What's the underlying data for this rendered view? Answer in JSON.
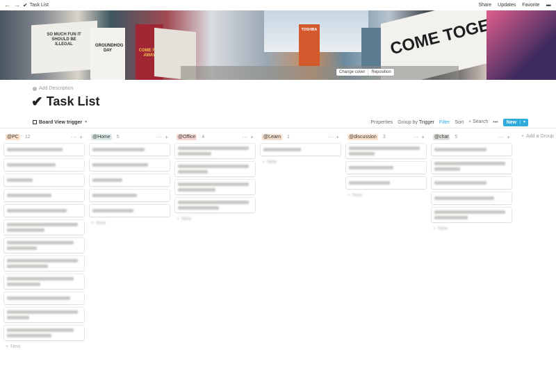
{
  "topbar": {
    "back_icon": "arrow-left-icon",
    "forward_icon": "arrow-right-icon",
    "page_icon": "checkmark-icon",
    "page_title": "Task List",
    "share": "Share",
    "updates": "Updates",
    "favorite": "Favorite",
    "more": "•••"
  },
  "cover": {
    "change_cover": "Change cover",
    "reposition": "Reposition",
    "billboard_texts": [
      "SO MUCH FUN IT SHOULD BE ILLEGAL",
      "GROUNDHOG DAY",
      "COME FLY AWAY",
      "TOSHIBA",
      "COME TOGE"
    ]
  },
  "header": {
    "add_description": "Add Description",
    "title_icon": "✔",
    "title": "Task List"
  },
  "viewbar": {
    "view_name": "Board View trigger",
    "properties": "Properties",
    "group_by_label": "Group by",
    "group_by_value": "Trigger",
    "filter": "Filter",
    "sort": "Sort",
    "search": "Search",
    "more": "•••",
    "new": "New"
  },
  "board": {
    "columns": [
      {
        "tag": "@PC",
        "count": "12",
        "color": "#fbe4cf"
      },
      {
        "tag": "@Home",
        "count": "5",
        "color": "#dce9ea"
      },
      {
        "tag": "@Office",
        "count": "4",
        "color": "#f7d9d6"
      },
      {
        "tag": "@Learn",
        "count": "1",
        "color": "#f4dfcf"
      },
      {
        "tag": "@discussion",
        "count": "3",
        "color": "#fbe4cf"
      },
      {
        "tag": "@chat",
        "count": "5",
        "color": "#e3e2e0"
      }
    ],
    "new_label": "New",
    "add_group": "Add a Group"
  },
  "colors": {
    "accent": "#2eaadc"
  }
}
